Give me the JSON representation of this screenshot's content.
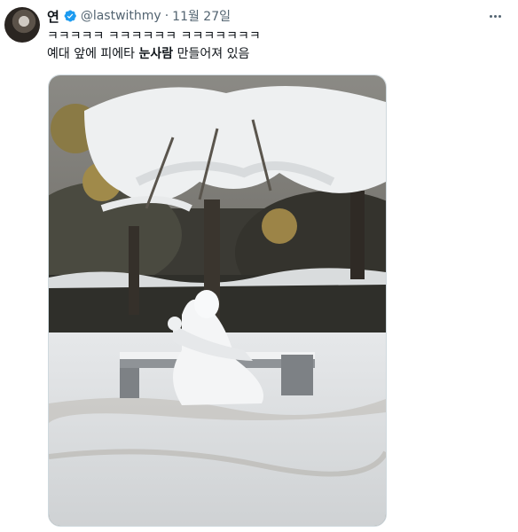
{
  "tweet": {
    "display_name": "연",
    "handle": "@lastwithmy",
    "separator": "·",
    "date": "11월 27일",
    "text_line1": "ㅋㅋㅋㅋㅋ ㅋㅋㅋㅋㅋㅋ ㅋㅋㅋㅋㅋㅋㅋ",
    "text_line2_prefix": "예대 앞에 피에타 ",
    "text_line2_bold": "눈사람",
    "text_line2_suffix": " 만들어져 있음"
  },
  "icons": {
    "verified": "verified-badge-icon",
    "more": "more-options-icon"
  },
  "colors": {
    "verified_blue": "#1d9bf0",
    "secondary_text": "#536471"
  }
}
